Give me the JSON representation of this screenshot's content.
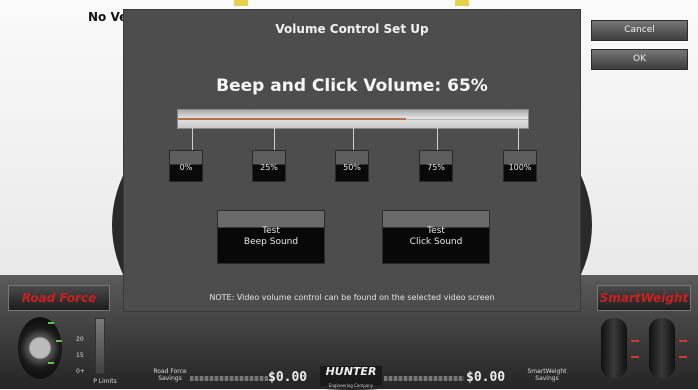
{
  "background": {
    "title": "No Vel"
  },
  "side_buttons": {
    "cancel": "Cancel",
    "ok": "OK"
  },
  "dialog": {
    "title": "Volume Control Set Up",
    "heading": "Beep and Click Volume: 65%",
    "volume_percent": 65,
    "presets": [
      "0%",
      "25%",
      "50%",
      "75%",
      "100%"
    ],
    "test_beep": {
      "line1": "Test",
      "line2": "Beep Sound"
    },
    "test_click": {
      "line1": "Test",
      "line2": "Click Sound"
    },
    "note": "NOTE: Video volume control can be found on the selected video screen"
  },
  "bottom": {
    "road_force": "Road Force",
    "smartweight": "SmartWeight",
    "gauge_labels": [
      "20",
      "15",
      "0+"
    ],
    "p_limits": "P Limits",
    "road_force_savings": [
      "Road Force",
      "Savings"
    ],
    "road_force_amount": "$0.00",
    "smartweight_amount": "$0.00",
    "smartweight_savings": [
      "SmartWeight",
      "Savings"
    ],
    "hunter": "HUNTER",
    "hunter_sub": "Engineering Company"
  },
  "colors": {
    "dialog_bg": "#4d4d4d",
    "brand_red": "#cc2020",
    "slider_fill": "#b8704a"
  }
}
